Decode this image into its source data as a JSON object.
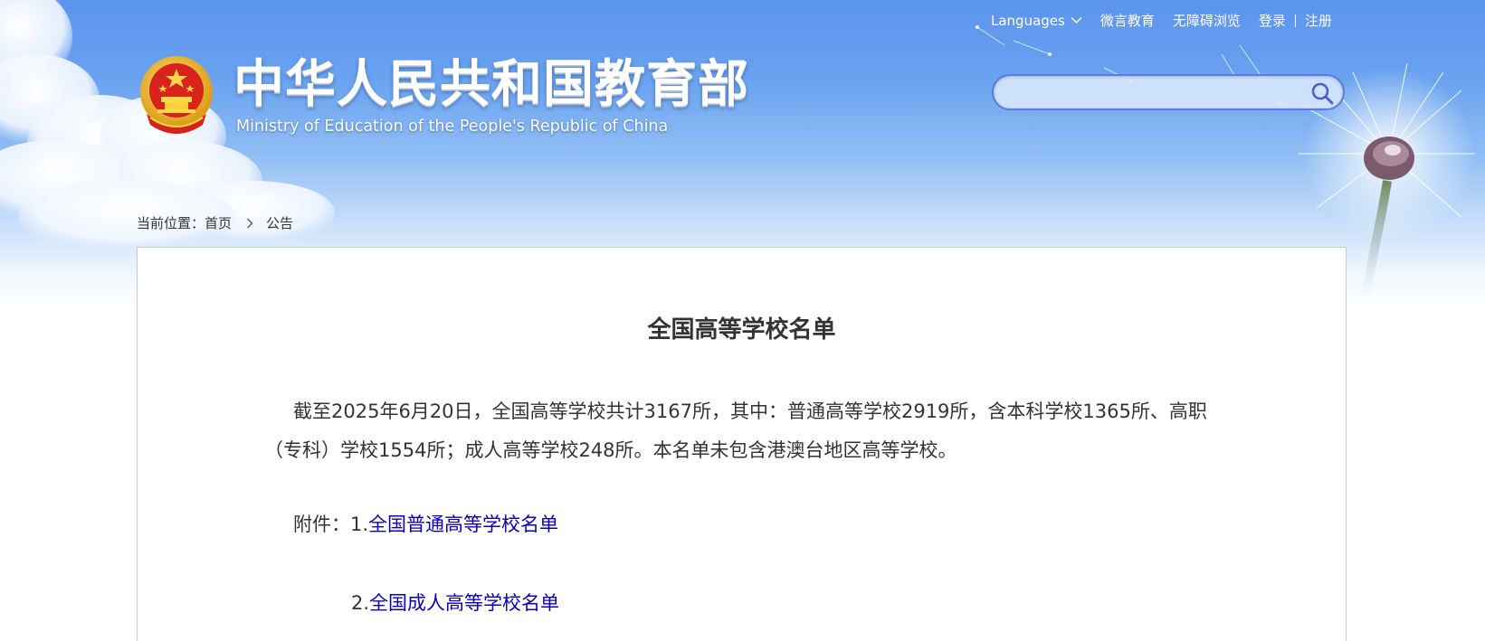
{
  "header": {
    "title_cn": "中华人民共和国教育部",
    "title_en": "Ministry of Education of the People's Republic of China",
    "emblem_icon": "national-emblem-icon"
  },
  "toplinks": {
    "languages": "Languages",
    "weiyan": "微言教育",
    "accessible": "无障碍浏览",
    "login": "登录",
    "register": "注册"
  },
  "search": {
    "value": "",
    "placeholder": "",
    "icon": "search-icon"
  },
  "breadcrumb": {
    "prefix": "当前位置：",
    "home": "首页",
    "current": "公告"
  },
  "article": {
    "title": "全国高等学校名单",
    "paragraph": "截至2025年6月20日，全国高等学校共计3167所，其中：普通高等学校2919所，含本科学校1365所、高职（专科）学校1554所；成人高等学校248所。本名单未包含港澳台地区高等学校。",
    "attachment_label": "附件：",
    "attachments": [
      {
        "num": "1.",
        "text": "全国普通高等学校名单"
      },
      {
        "num": "2.",
        "text": "全国成人高等学校名单"
      }
    ]
  },
  "colors": {
    "sky_top": "#5b94ec",
    "link": "#0c00b4",
    "search_border": "#5f79df",
    "text": "#333333"
  }
}
